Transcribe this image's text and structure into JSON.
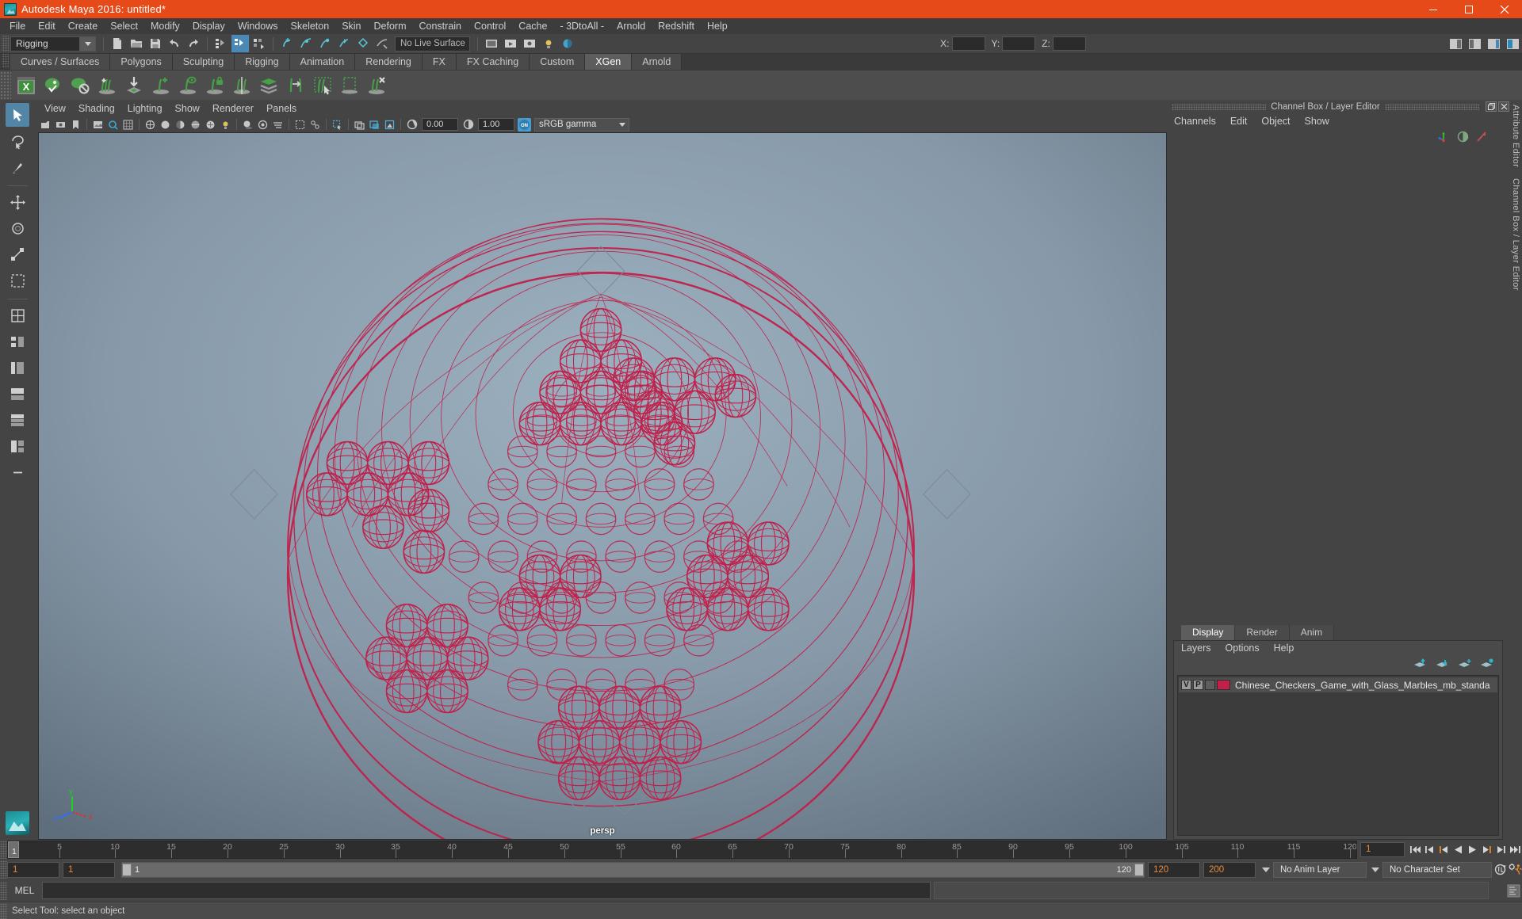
{
  "window": {
    "title": "Autodesk Maya 2016: untitled*",
    "logo_icon": "maya-logo-icon",
    "minimize_label": "—",
    "maximize_label": "❐",
    "close_label": "✕"
  },
  "menubar": {
    "items": [
      {
        "label": "File"
      },
      {
        "label": "Edit"
      },
      {
        "label": "Create"
      },
      {
        "label": "Select"
      },
      {
        "label": "Modify"
      },
      {
        "label": "Display"
      },
      {
        "label": "Windows"
      },
      {
        "label": "Skeleton"
      },
      {
        "label": "Skin"
      },
      {
        "label": "Deform"
      },
      {
        "label": "Constrain"
      },
      {
        "label": "Control"
      },
      {
        "label": "Cache"
      },
      {
        "label": "- 3DtoAll -"
      },
      {
        "label": "Arnold"
      },
      {
        "label": "Redshift"
      },
      {
        "label": "Help"
      }
    ]
  },
  "toolbar": {
    "menu_set": "Rigging",
    "live_surface": "No Live Surface",
    "coord_x_label": "X:",
    "coord_y_label": "Y:",
    "coord_z_label": "Z:",
    "coord_x_value": "",
    "coord_y_value": "",
    "coord_z_value": "",
    "icons": [
      "new-scene-icon",
      "open-scene-icon",
      "save-scene-icon",
      "undo-icon",
      "redo-icon",
      "select-hierarchy-icon",
      "select-object-icon",
      "select-component-icon",
      "snap-to-grid-icon",
      "snap-to-curve-icon",
      "snap-to-point-icon",
      "snap-to-projected-icon",
      "snap-to-view-plane-icon",
      "make-live-icon"
    ],
    "right_icons": [
      "render-view-icon",
      "render-settings-icon",
      "hypershade-icon",
      "outliner-icon"
    ]
  },
  "shelf": {
    "tabs": [
      {
        "label": "Curves / Surfaces",
        "active": false
      },
      {
        "label": "Polygons",
        "active": false
      },
      {
        "label": "Sculpting",
        "active": false
      },
      {
        "label": "Rigging",
        "active": false
      },
      {
        "label": "Animation",
        "active": false
      },
      {
        "label": "Rendering",
        "active": false
      },
      {
        "label": "FX",
        "active": false
      },
      {
        "label": "FX Caching",
        "active": false
      },
      {
        "label": "Custom",
        "active": false
      },
      {
        "label": "XGen",
        "active": true
      },
      {
        "label": "Arnold",
        "active": false
      }
    ],
    "icons": [
      "xgen-editor-icon",
      "xgen-preview-icon",
      "xgen-disable-preview-icon",
      "xgen-add-grooming-icon",
      "xgen-import-collection-icon",
      "xgen-add-description-icon",
      "xgen-preview-description-icon",
      "xgen-lock-description-icon",
      "xgen-mirror-description-icon",
      "xgen-layers-icon",
      "xgen-convert-icon",
      "xgen-select-guides-icon",
      "xgen-region-icon",
      "xgen-delete-guides-icon"
    ]
  },
  "left_toolbox": {
    "tools": [
      {
        "name": "select-tool",
        "selected": true
      },
      {
        "name": "lasso-select-tool",
        "selected": false
      },
      {
        "name": "paint-select-tool",
        "selected": false
      },
      {
        "name": "move-tool",
        "selected": false
      },
      {
        "name": "rotate-tool",
        "selected": false
      },
      {
        "name": "scale-tool",
        "selected": false
      },
      {
        "name": "last-tool-icon",
        "selected": false
      },
      {
        "name": "layout-single-icon",
        "selected": false
      },
      {
        "name": "layout-four-view-icon",
        "selected": false
      },
      {
        "name": "layout-persp-outliner-icon",
        "selected": false
      },
      {
        "name": "layout-persp-graph-icon",
        "selected": false
      },
      {
        "name": "layout-hypershade-icon",
        "selected": false
      },
      {
        "name": "layout-persp-uv-icon",
        "selected": false
      },
      {
        "name": "layout-more-icon",
        "selected": false
      }
    ]
  },
  "viewport": {
    "menus": [
      {
        "label": "View"
      },
      {
        "label": "Shading"
      },
      {
        "label": "Lighting"
      },
      {
        "label": "Show"
      },
      {
        "label": "Renderer"
      },
      {
        "label": "Panels"
      }
    ],
    "exposure_value": "0.00",
    "gamma_value": "1.00",
    "color_management": "sRGB gamma",
    "color_management_toggle": "ON",
    "camera_label": "persp",
    "axis_x_label": "x",
    "axis_y_label": "y",
    "axis_z_label": "z",
    "wireframe_color": "#c0204a",
    "background_top": "#8fa4b4",
    "background_bottom": "#5d6c7a"
  },
  "channel_box": {
    "title": "Channel Box / Layer Editor",
    "restore_icon": "restore-panel-icon",
    "close_icon": "close-panel-icon",
    "menus": [
      {
        "label": "Channels"
      },
      {
        "label": "Edit"
      },
      {
        "label": "Object"
      },
      {
        "label": "Show"
      }
    ],
    "toolbar_icons": [
      "manipulator-icon",
      "half-circle-icon",
      "arrow-up-right-icon"
    ]
  },
  "layer_editor": {
    "tabs": [
      {
        "label": "Display",
        "active": true
      },
      {
        "label": "Render",
        "active": false
      },
      {
        "label": "Anim",
        "active": false
      }
    ],
    "menus": [
      {
        "label": "Layers"
      },
      {
        "label": "Options"
      },
      {
        "label": "Help"
      }
    ],
    "toolbar_icons": [
      "layer-move-up-icon",
      "layer-move-down-icon",
      "layer-new-icon",
      "layer-new-selected-icon"
    ],
    "layers": [
      {
        "visibility": "V",
        "playback": "P",
        "state": "",
        "color": "#c0204a",
        "name": "Chinese_Checkers_Game_with_Glass_Marbles_mb_standa"
      }
    ]
  },
  "right_edge": {
    "attribute_editor_label": "Attribute Editor",
    "channel_box_label": "Channel Box / Layer Editor"
  },
  "time_slider": {
    "ticks": [
      {
        "label": "5",
        "frame": 5
      },
      {
        "label": "10",
        "frame": 10
      },
      {
        "label": "15",
        "frame": 15
      },
      {
        "label": "20",
        "frame": 20
      },
      {
        "label": "25",
        "frame": 25
      },
      {
        "label": "30",
        "frame": 30
      },
      {
        "label": "35",
        "frame": 35
      },
      {
        "label": "40",
        "frame": 40
      },
      {
        "label": "45",
        "frame": 45
      },
      {
        "label": "50",
        "frame": 50
      },
      {
        "label": "55",
        "frame": 55
      },
      {
        "label": "60",
        "frame": 60
      },
      {
        "label": "65",
        "frame": 65
      },
      {
        "label": "70",
        "frame": 70
      },
      {
        "label": "75",
        "frame": 75
      },
      {
        "label": "80",
        "frame": 80
      },
      {
        "label": "85",
        "frame": 85
      },
      {
        "label": "90",
        "frame": 90
      },
      {
        "label": "95",
        "frame": 95
      },
      {
        "label": "100",
        "frame": 100
      },
      {
        "label": "105",
        "frame": 105
      },
      {
        "label": "110",
        "frame": 110
      },
      {
        "label": "115",
        "frame": 115
      },
      {
        "label": "120",
        "frame": 120
      }
    ],
    "current_frame": "1",
    "playhead_label": "1",
    "range_start": 1,
    "range_end": 120,
    "playback_buttons": [
      "go-to-start-icon",
      "step-back-keyframe-icon",
      "step-back-frame-icon",
      "play-backwards-icon",
      "play-forwards-icon",
      "step-forward-frame-icon",
      "step-forward-keyframe-icon",
      "go-to-end-icon"
    ]
  },
  "range_slider": {
    "anim_start": "1",
    "range_start": "1",
    "slider_left_label": "1",
    "slider_right_label": "120",
    "range_end": "120",
    "anim_end": "200",
    "anim_layer": "No Anim Layer",
    "character_set": "No Character Set",
    "auto_key_icon": "auto-keyframe-icon",
    "anim_prefs_icon": "animation-preferences-icon"
  },
  "command_line": {
    "language_label": "MEL",
    "input_value": "",
    "input_placeholder": "",
    "output_value": "",
    "script_editor_icon": "script-editor-icon"
  },
  "help_line": {
    "text": "Select Tool: select an object"
  }
}
